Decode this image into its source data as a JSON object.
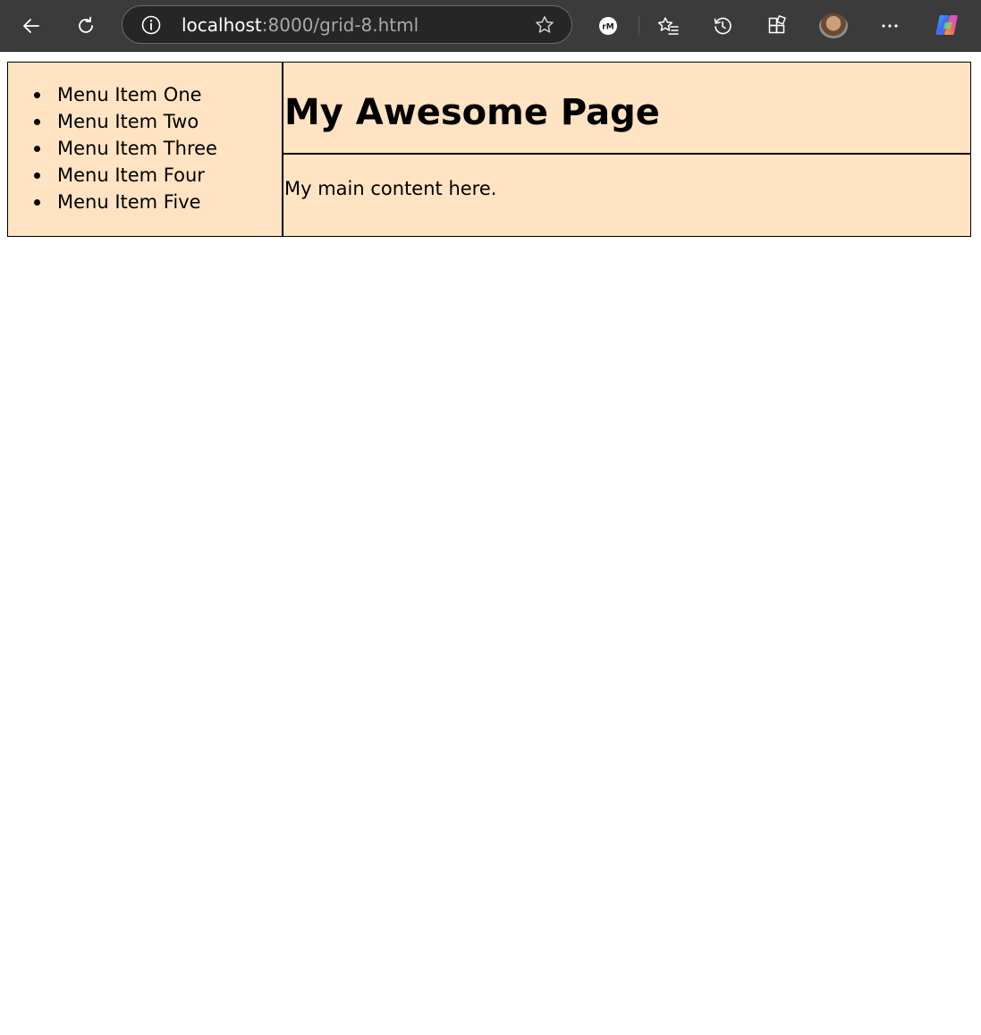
{
  "browser": {
    "url_host": "localhost",
    "url_path": ":8000/grid-8.html",
    "extension_badge": "rM",
    "icons": {
      "back": "back-arrow-icon",
      "refresh": "refresh-icon",
      "site_info": "info-icon",
      "favorite": "star-icon",
      "favorites_list": "favorites-icon",
      "history": "history-icon",
      "extensions": "extensions-icon",
      "more": "more-dots-icon",
      "copilot": "copilot-icon"
    },
    "colors": {
      "toolbar": "#3b3b3b",
      "address_bar": "#262626"
    }
  },
  "page": {
    "sidebar": {
      "items": [
        {
          "label": "Menu Item One"
        },
        {
          "label": "Menu Item Two"
        },
        {
          "label": "Menu Item Three"
        },
        {
          "label": "Menu Item Four"
        },
        {
          "label": "Menu Item Five"
        }
      ]
    },
    "header": {
      "title": "My Awesome Page"
    },
    "main": {
      "text": "My main content here."
    },
    "colors": {
      "cell_background": "#ffe3c2",
      "border": "#000000"
    }
  }
}
